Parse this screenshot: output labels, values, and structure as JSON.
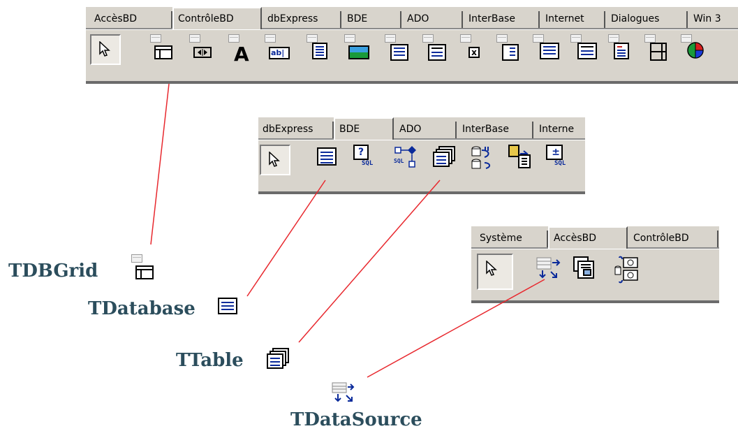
{
  "palette_top": {
    "tabs": [
      "AccèsBD",
      "ContrôleBD",
      "dbExpress",
      "BDE",
      "ADO",
      "InterBase",
      "Internet",
      "Dialogues",
      "Win 3"
    ],
    "active_tab": "ContrôleBD",
    "icons": [
      "arrow-pointer-icon",
      "dbgrid-icon",
      "dbnavigator-icon",
      "dbtext-icon",
      "dbedit-icon",
      "dbmemo-icon",
      "dbimage-icon",
      "dblistbox-icon",
      "dbcombobox-icon",
      "dbcheckbox-icon",
      "dbradiogroup-icon",
      "dblookuplistbox-icon",
      "dblookupcombobox-icon",
      "dbrichedit-icon",
      "dbctrlgrid-icon",
      "dbchart-icon"
    ]
  },
  "palette_bde": {
    "tabs": [
      "dbExpress",
      "BDE",
      "ADO",
      "InterBase",
      "Interne"
    ],
    "active_tab": "BDE",
    "icons": [
      "arrow-pointer-icon",
      "table-icon",
      "query-icon",
      "storedproc-icon",
      "database-icon",
      "session-icon",
      "batchmove-icon",
      "updatesql-icon"
    ]
  },
  "palette_access": {
    "tabs": [
      "Système",
      "AccèsBD",
      "ContrôleBD"
    ],
    "active_tab": "AccèsBD",
    "icons": [
      "arrow-pointer-icon",
      "datasource-icon",
      "clientdataset-icon",
      "datasetprovider-icon"
    ]
  },
  "labels": {
    "dbgrid": "TDBGrid",
    "database": "TDatabase",
    "table": "TTable",
    "datasource": "TDataSource"
  },
  "colors": {
    "palette_bg": "#d8d4cc",
    "connector_line": "#e8282e",
    "label_text": "#2b4d5c",
    "icon_blue": "#0a2a9a"
  }
}
